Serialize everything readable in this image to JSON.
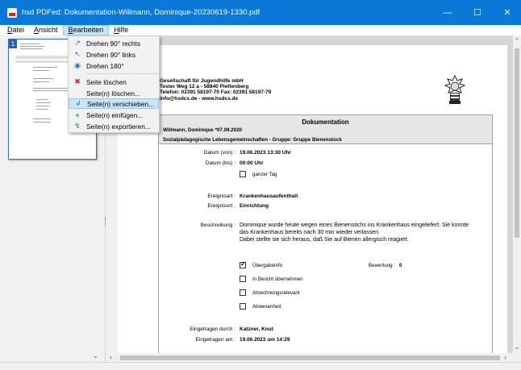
{
  "window": {
    "title": "hsd PDFed: Dokumentation-Willmann, Dominique-20230619-1330.pdf",
    "minimize_glyph": "—",
    "maximize_glyph": "☐",
    "close_glyph": "✕"
  },
  "menu": {
    "datei": "atei",
    "datei_ul": "D",
    "ansicht_pre": "",
    "ansicht_ul": "A",
    "ansicht": "nsicht",
    "bearbeiten_ul": "B",
    "bearbeiten": "earbeiten",
    "hilfe_ul": "H",
    "hilfe": "ilfe"
  },
  "dropdown": {
    "items": [
      {
        "label": "Drehen 90° rechts",
        "icon": "rotate-right-icon",
        "glyph": "↗"
      },
      {
        "label": "Drehen 90° links",
        "icon": "rotate-left-icon",
        "glyph": "↖"
      },
      {
        "label": "Drehen 180°",
        "icon": "rotate-180-icon",
        "glyph": "◉"
      },
      {
        "label": "Seite löschen",
        "icon": "delete-icon",
        "glyph": "✖"
      },
      {
        "label": "Seite(n) löschen...",
        "icon": "delete-pages-icon",
        "glyph": ""
      },
      {
        "label": "Seite(n) verschieben...",
        "icon": "move-pages-icon",
        "glyph": "↲"
      },
      {
        "label": "Seite(n) einfügen...",
        "icon": "insert-pages-icon",
        "glyph": "+"
      },
      {
        "label": "Seite(n) exportieren...",
        "icon": "export-pages-icon",
        "glyph": "↯"
      }
    ]
  },
  "thumbnail": {
    "page_number": "1"
  },
  "company": {
    "line1": "Gesellschaft für Jugendhilfe mbH",
    "line2": "Tester Weg 12 a - 58840 Plettenberg",
    "line3": "Telefon: 02391 58197-70  Fax: 02391 58197-79",
    "line4": "info@hsdcs.de - www.hsdcs.de"
  },
  "doc": {
    "title": "Dokumentation",
    "person": "Willmann, Dominique *07.09.2020",
    "group": "Sozialpädagogische Lebensgemeinschaften - Gruppe: Gruppe Bienenstock",
    "datum_von_label": "Datum (von) :",
    "datum_von": "19.06.2023  13:30 Uhr",
    "datum_bis_label": "Datum (bis) :",
    "datum_bis": "00:00 Uhr",
    "ganzer_tag": "ganzer Tag",
    "ereignisart_label": "Ereignisart :",
    "ereignisart": "Krankenhausaufenthalt",
    "ereignisort_label": "Ereignisort :",
    "ereignisort": "Einrichtung",
    "beschreibung_label": "Beschreibung :",
    "beschreibung_1": "Dominique wurde heute wegen eines Bienenstichs ins Krankenhaus eingeliefert. Sie konnte",
    "beschreibung_2": "das Krankenhaus bereits nach 30 min wieder verlassen.",
    "beschreibung_3": "Dabei stellte sie sich heraus, daß Sie auf Bienen allergisch reagiert.",
    "uebergabeinfo": "Übergabeinfo",
    "bewertung_label": "Bewertung :",
    "bewertung": "0",
    "in_bericht": "In Bericht übernehmen",
    "abrechnung": "Abrechnungsrelevant",
    "abwesenheit": "Abwesenheit",
    "eingetragen_durch_label": "Eingetragen durch :",
    "eingetragen_durch": "Katzner, Knut",
    "eingetragen_am_label": "Eingetragen am :",
    "eingetragen_am": "19.06.2023  um 14:29"
  }
}
